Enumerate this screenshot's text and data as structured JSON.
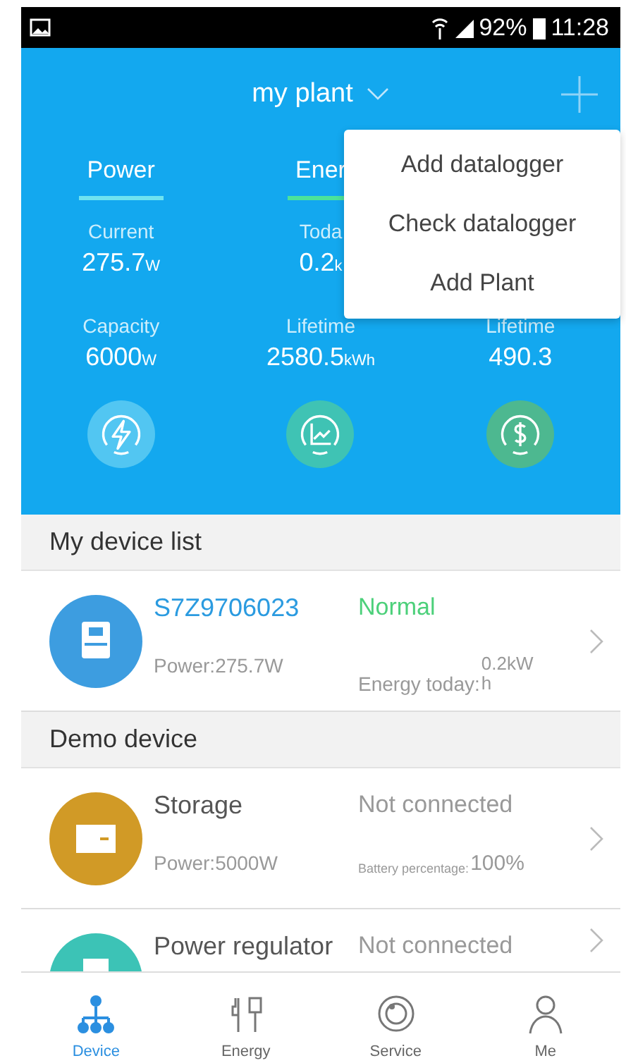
{
  "status_bar": {
    "battery": "92%",
    "time": "11:28"
  },
  "header": {
    "title": "my plant"
  },
  "tabs": [
    {
      "label": "Power",
      "color": "#6fe3f0"
    },
    {
      "label": "Ener",
      "color": "#4be39a"
    }
  ],
  "stats": [
    [
      {
        "label": "Current",
        "value": "275.7",
        "unit": "W"
      },
      {
        "label": "Toda",
        "value": "0.2",
        "unit": "k"
      }
    ],
    [
      {
        "label": "Capacity",
        "value": "6000",
        "unit": "W"
      },
      {
        "label": "Lifetime",
        "value": "2580.5",
        "unit": "kWh"
      },
      {
        "label": "Lifetime",
        "value": "490.3"
      }
    ]
  ],
  "shortcuts": [
    {
      "kind": "power",
      "color": "#52c6f2"
    },
    {
      "kind": "chart",
      "color": "#3fc3b4"
    },
    {
      "kind": "money",
      "color": "#4db890"
    }
  ],
  "menu": [
    "Add datalogger",
    "Check datalogger",
    "Add Plant"
  ],
  "sections": [
    {
      "title": "My device list",
      "devices": [
        {
          "kind": "inverter",
          "color": "#3d9de0",
          "name": "S7Z9706023",
          "online": true,
          "status": "Normal",
          "power": "Power:275.7W",
          "detail_label": "Energy today:",
          "detail_value": "0.2kWh"
        }
      ]
    },
    {
      "title": "Demo device",
      "devices": [
        {
          "kind": "storage",
          "color": "#d19a26",
          "name": "Storage",
          "online": false,
          "status": "Not connected",
          "power": "Power:5000W",
          "detail_label": "Battery percentage:",
          "detail_value": "100%"
        },
        {
          "kind": "regulator",
          "color": "#3cc3b6",
          "name": "Power regulator",
          "online": false,
          "status": "Not connected"
        }
      ]
    }
  ],
  "nav": [
    {
      "kind": "device",
      "label": "Device",
      "selected": true
    },
    {
      "kind": "energy",
      "label": "Energy",
      "selected": false
    },
    {
      "kind": "service",
      "label": "Service",
      "selected": false
    },
    {
      "kind": "me",
      "label": "Me",
      "selected": false
    }
  ]
}
